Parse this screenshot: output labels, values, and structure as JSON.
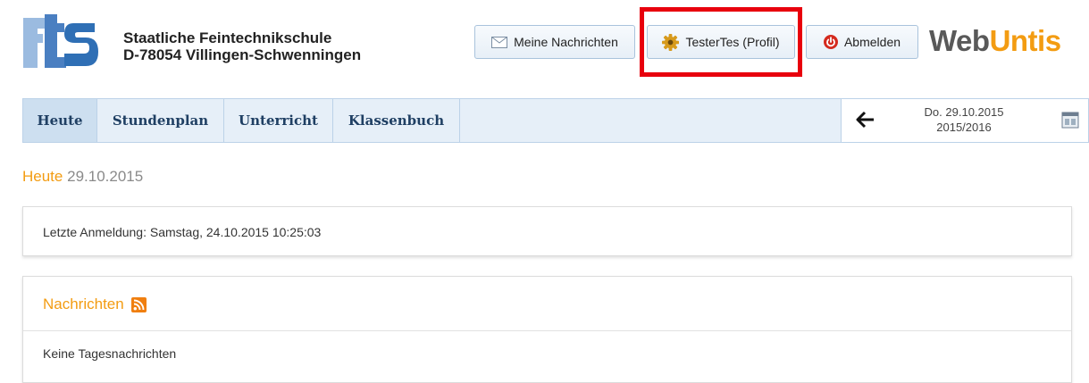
{
  "header": {
    "school_line1": "Staatliche Feintechnikschule",
    "school_line2": "D-78054 Villingen-Schwenningen",
    "buttons": {
      "messages": "Meine Nachrichten",
      "profile": "TesterTes (Profil)",
      "logout": "Abmelden"
    },
    "brand": {
      "part1": "Web",
      "part2": "Untis"
    },
    "highlighted_button": "profile"
  },
  "nav": {
    "tabs": [
      "Heute",
      "Stundenplan",
      "Unterricht",
      "Klassenbuch"
    ],
    "active_tab": "Heute",
    "date_line1": "Do. 29.10.2015",
    "date_line2": "2015/2016"
  },
  "main": {
    "title": "Heute",
    "date": "29.10.2015",
    "last_login": "Letzte Anmeldung: Samstag, 24.10.2015 10:25:03",
    "messages_title": "Nachrichten",
    "messages_empty": "Keine Tagesnachrichten"
  },
  "colors": {
    "accent_orange": "#f39c12",
    "nav_bg": "#e6eff8",
    "nav_text": "#1f3f63",
    "highlight_red": "#e8000d"
  },
  "icons": {
    "school_logo": "fts-logo",
    "messages": "envelope-icon",
    "profile": "gear-icon",
    "logout": "power-icon",
    "prev_day": "arrow-left-icon",
    "calendar": "calendar-icon",
    "rss": "rss-icon"
  }
}
